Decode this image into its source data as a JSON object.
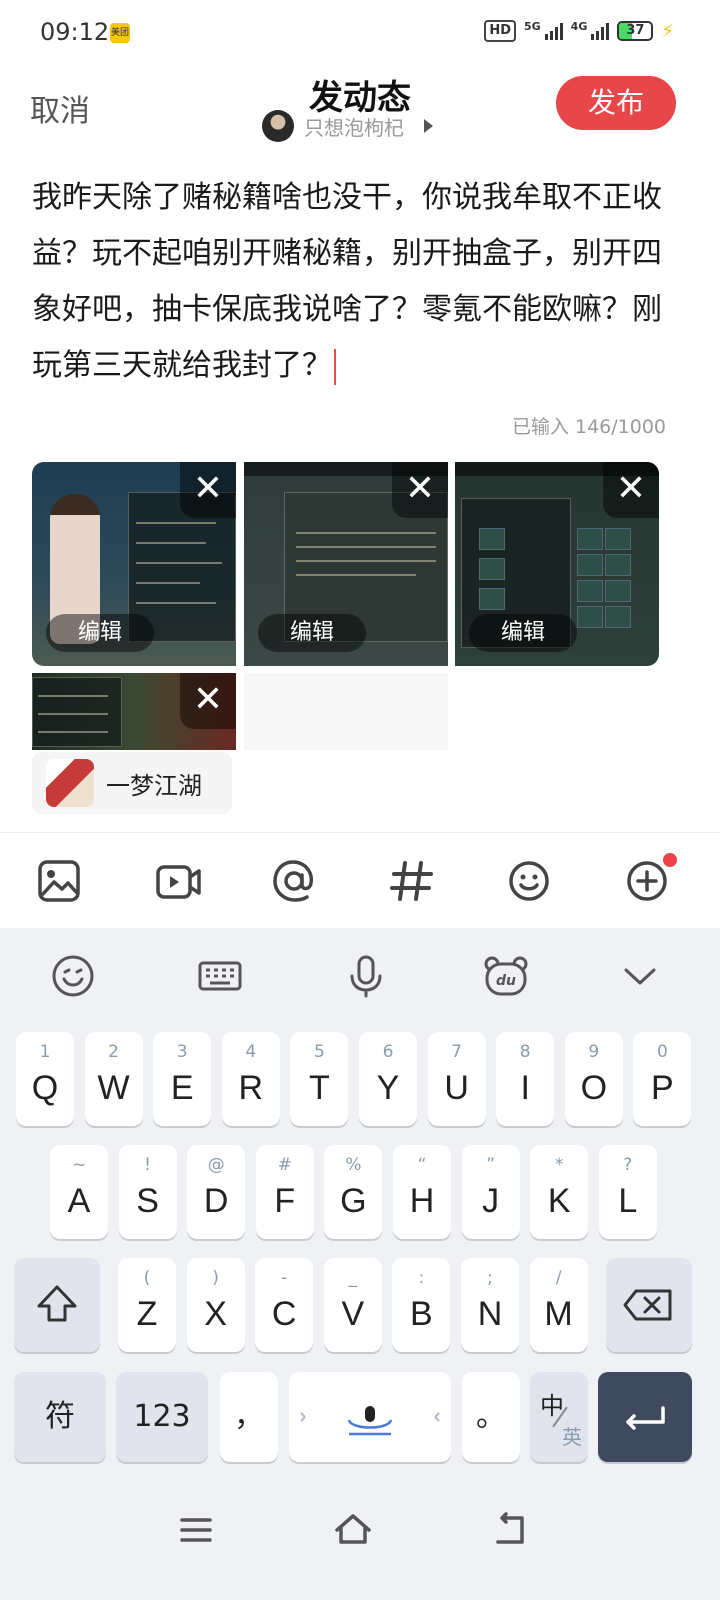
{
  "status_bar": {
    "time": "09:12",
    "app_badge": "美团",
    "hd_label": "HD",
    "net1": "5G",
    "net2": "4G",
    "battery": "37"
  },
  "header": {
    "cancel_label": "取消",
    "title": "发动态",
    "identity_name": "只想泡枸杞",
    "publish_label": "发布"
  },
  "post": {
    "text": "我昨天除了赌秘籍啥也没干，你说我牟取不正收益？玩不起咱别开赌秘籍，别开抽盒子，别开四象好吧，抽卡保底我说啥了？零氪不能欧嘛？刚玩第三天就给我封了？",
    "char_count": "已输入 146/1000"
  },
  "images": {
    "close_glyph": "✕",
    "edit_label": "编辑"
  },
  "topic": {
    "label": "一梦江湖"
  },
  "keyboard": {
    "row1": [
      {
        "main": "Q",
        "sub": "1"
      },
      {
        "main": "W",
        "sub": "2"
      },
      {
        "main": "E",
        "sub": "3"
      },
      {
        "main": "R",
        "sub": "4"
      },
      {
        "main": "T",
        "sub": "5"
      },
      {
        "main": "Y",
        "sub": "6"
      },
      {
        "main": "U",
        "sub": "7"
      },
      {
        "main": "I",
        "sub": "8"
      },
      {
        "main": "O",
        "sub": "9"
      },
      {
        "main": "P",
        "sub": "0"
      }
    ],
    "row2": [
      {
        "main": "A",
        "sub": "~"
      },
      {
        "main": "S",
        "sub": "!"
      },
      {
        "main": "D",
        "sub": "@"
      },
      {
        "main": "F",
        "sub": "#"
      },
      {
        "main": "G",
        "sub": "%"
      },
      {
        "main": "H",
        "sub": "“"
      },
      {
        "main": "J",
        "sub": "”"
      },
      {
        "main": "K",
        "sub": "*"
      },
      {
        "main": "L",
        "sub": "?"
      }
    ],
    "row3": [
      {
        "main": "Z",
        "sub": "("
      },
      {
        "main": "X",
        "sub": ")"
      },
      {
        "main": "C",
        "sub": "-"
      },
      {
        "main": "V",
        "sub": "_"
      },
      {
        "main": "B",
        "sub": ":"
      },
      {
        "main": "N",
        "sub": ";"
      },
      {
        "main": "M",
        "sub": "/"
      }
    ],
    "symbol_label": "符",
    "num_label": "123",
    "comma_label": "，",
    "period_label": "。",
    "lang_top": "中",
    "lang_bottom": "英"
  },
  "colors": {
    "accent": "#e8474a",
    "keyboard_bg": "#f0f1f5",
    "enter_key": "#3f4a5e"
  }
}
